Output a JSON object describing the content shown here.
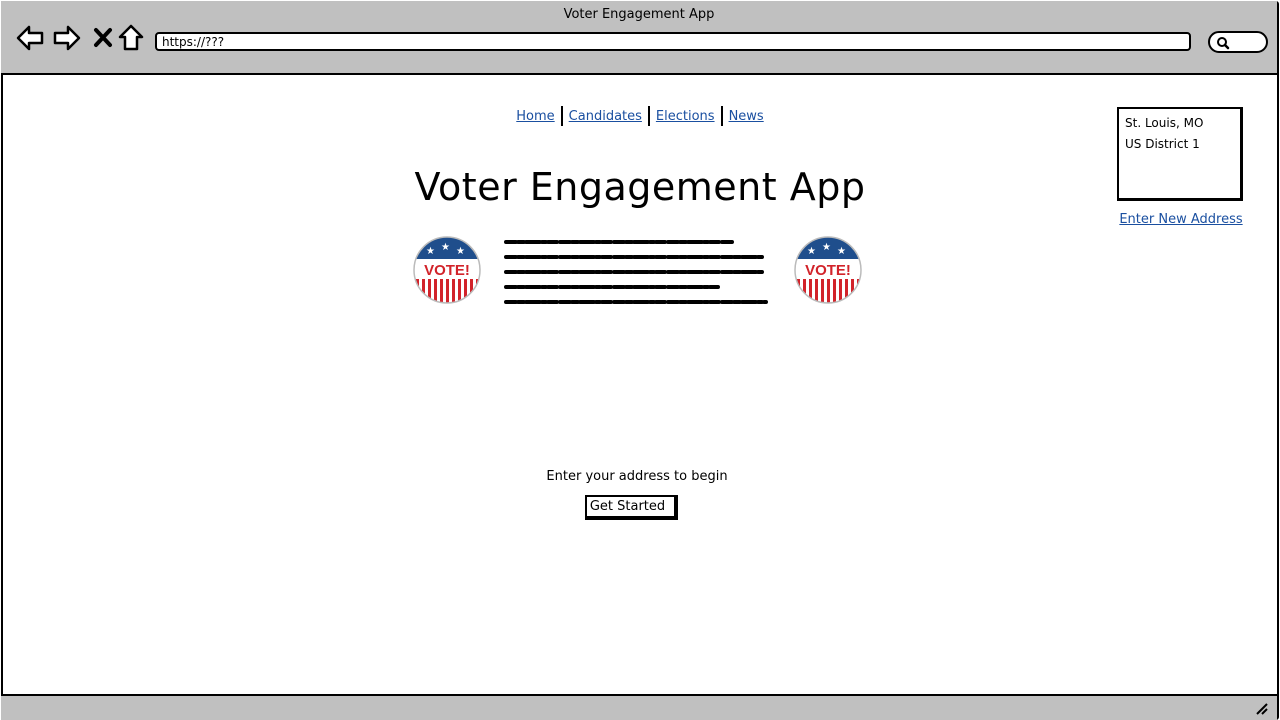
{
  "window": {
    "title": "Voter Engagement App"
  },
  "browser": {
    "url": "https://???",
    "icons": [
      "back-arrow-icon",
      "forward-arrow-icon",
      "close-icon",
      "home-icon",
      "search-icon"
    ]
  },
  "nav": {
    "home": "Home",
    "candidates": "Candidates",
    "elections": "Elections",
    "news": "News"
  },
  "page": {
    "title": "Voter Engagement App",
    "badge_text": "VOTE!",
    "prompt": "Enter your address to begin",
    "button": "Get Started"
  },
  "address": {
    "city": "St. Louis, MO",
    "district": "US District 1",
    "change_link": "Enter New Address"
  },
  "colors": {
    "link": "#1a4fa0",
    "badge_blue": "#1f4e8c",
    "badge_red": "#d2232a",
    "chrome": "#c0c0c0"
  }
}
